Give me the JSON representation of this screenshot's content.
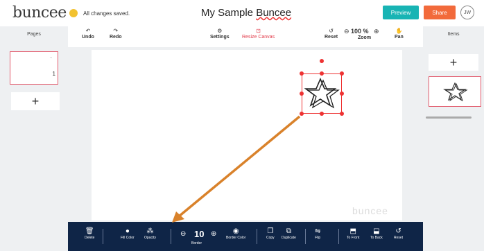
{
  "header": {
    "logo": "buncee",
    "save_status": "All changes saved.",
    "title_prefix": "My Sample ",
    "title_word": "Buncee",
    "preview_label": "Preview",
    "share_label": "Share",
    "avatar_initials": "JW"
  },
  "pages_panel": {
    "title": "Pages",
    "page_number": "1",
    "add_label": "+"
  },
  "items_panel": {
    "title": "Items",
    "add_label": "+"
  },
  "toolbar": {
    "undo": "Undo",
    "redo": "Redo",
    "settings": "Settings",
    "resize": "Resize Canvas",
    "reset": "Reset",
    "zoom_value": "100 %",
    "zoom": "Zoom",
    "pan": "Pan"
  },
  "canvas": {
    "watermark": "buncee"
  },
  "bottom_toolbar": {
    "delete": "Delete",
    "fill_color": "Fill Color",
    "opacity": "Opacity",
    "border_value": "10",
    "border": "Border",
    "border_color": "Border Color",
    "copy": "Copy",
    "duplicate": "Duplicate",
    "flip": "Flip",
    "to_front": "To Front",
    "to_back": "To Back",
    "reset": "Reset"
  },
  "colors": {
    "preview": "#18b4b4",
    "share": "#f26a3b",
    "selection": "#e33333",
    "bottombar": "#0f2547",
    "arrow": "#d9822b"
  }
}
